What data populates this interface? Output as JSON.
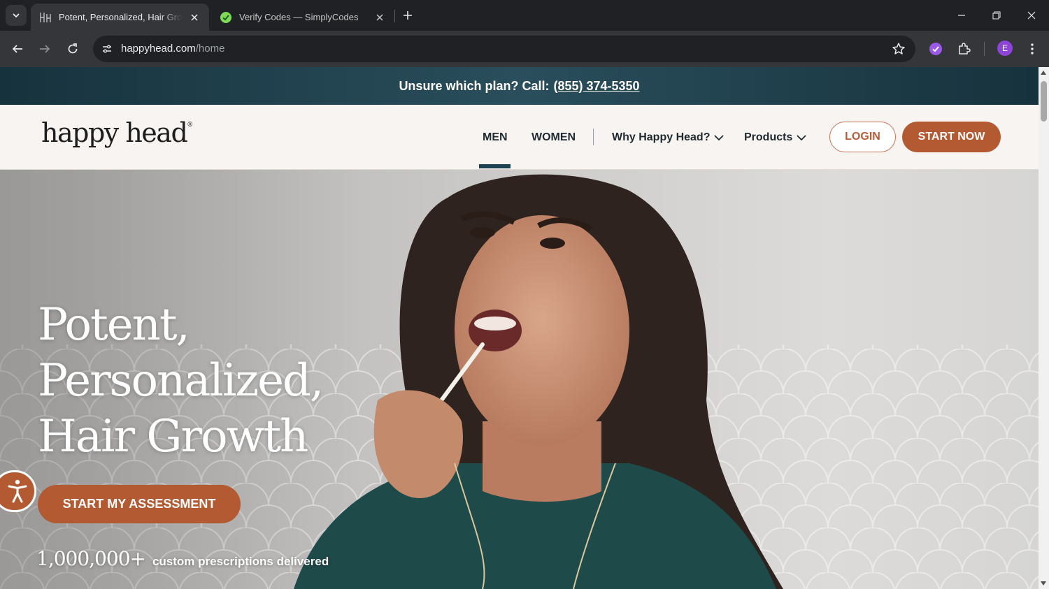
{
  "browser": {
    "tabs": [
      {
        "title": "Potent, Personalized, Hair Growth",
        "favicon": "happyhead-favicon",
        "active": true
      },
      {
        "title": "Verify Codes — SimplyCodes",
        "favicon": "simplycodes-favicon",
        "active": false
      }
    ],
    "url": {
      "host": "happyhead.com",
      "path": "/home"
    },
    "profile_initial": "E"
  },
  "promo": {
    "text": "Unsure which plan? Call:",
    "phone": "(855) 374-5350"
  },
  "nav": {
    "logo": "happy head",
    "links": {
      "men": "MEN",
      "women": "WOMEN",
      "why": "Why Happy Head?",
      "products": "Products"
    },
    "login": "LOGIN",
    "start": "START NOW"
  },
  "hero": {
    "headline_lines": [
      "Potent,",
      "Personalized,",
      "Hair Growth"
    ],
    "cta": "START MY ASSESSMENT",
    "stat_number": "1,000,000+",
    "stat_text": "custom prescriptions delivered"
  },
  "colors": {
    "brand_orange": "#b45a32",
    "promo_teal": "#1c3d4a",
    "nav_active": "#1c4150"
  }
}
